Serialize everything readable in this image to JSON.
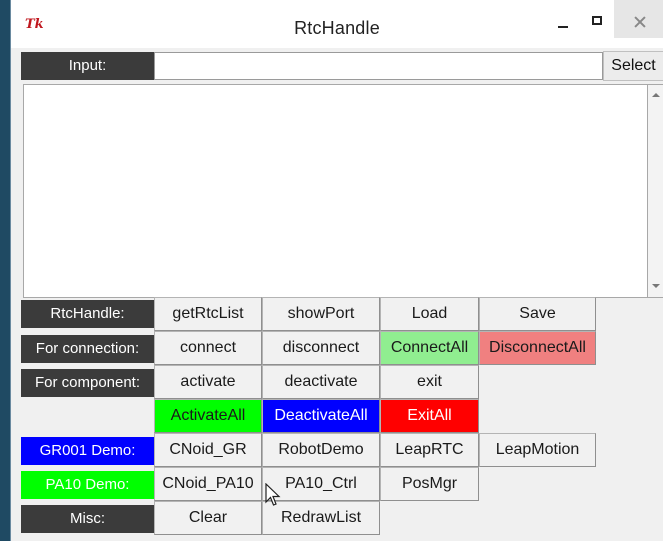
{
  "window": {
    "title": "RtcHandle",
    "icon_text": "Tk"
  },
  "input": {
    "label": "Input:",
    "value": "",
    "select_label": "Select"
  },
  "output": {
    "text": ""
  },
  "rows": {
    "rtchandle": {
      "label": "RtcHandle:",
      "buttons": [
        "getRtcList",
        "showPort",
        "Load",
        "Save"
      ]
    },
    "connection": {
      "label": "For connection:",
      "buttons": [
        "connect",
        "disconnect",
        "ConnectAll",
        "DisconnectAll"
      ]
    },
    "component": {
      "label": "For component:",
      "buttons": [
        "activate",
        "deactivate",
        "exit"
      ]
    },
    "component_all": {
      "buttons": [
        "ActivateAll",
        "DeactivateAll",
        "ExitAll"
      ]
    },
    "gr001": {
      "label": "GR001 Demo:",
      "buttons": [
        "CNoid_GR",
        "RobotDemo",
        "LeapRTC",
        "LeapMotion"
      ]
    },
    "pa10": {
      "label": "PA10 Demo:",
      "buttons": [
        "CNoid_PA10",
        "PA10_Ctrl",
        "PosMgr"
      ]
    },
    "misc": {
      "label": "Misc:",
      "buttons": [
        "Clear",
        "RedrawList"
      ]
    }
  },
  "colors": {
    "label_dark": "#3b3b3b",
    "gr001_label": "#0000ff",
    "pa10_label": "#00ff00",
    "activate_all": "#00ff00",
    "deactivate_all": "#0000ff",
    "exit_all": "#ff0000",
    "connect_all": "#90ee90",
    "disconnect_all": "#f08080"
  }
}
